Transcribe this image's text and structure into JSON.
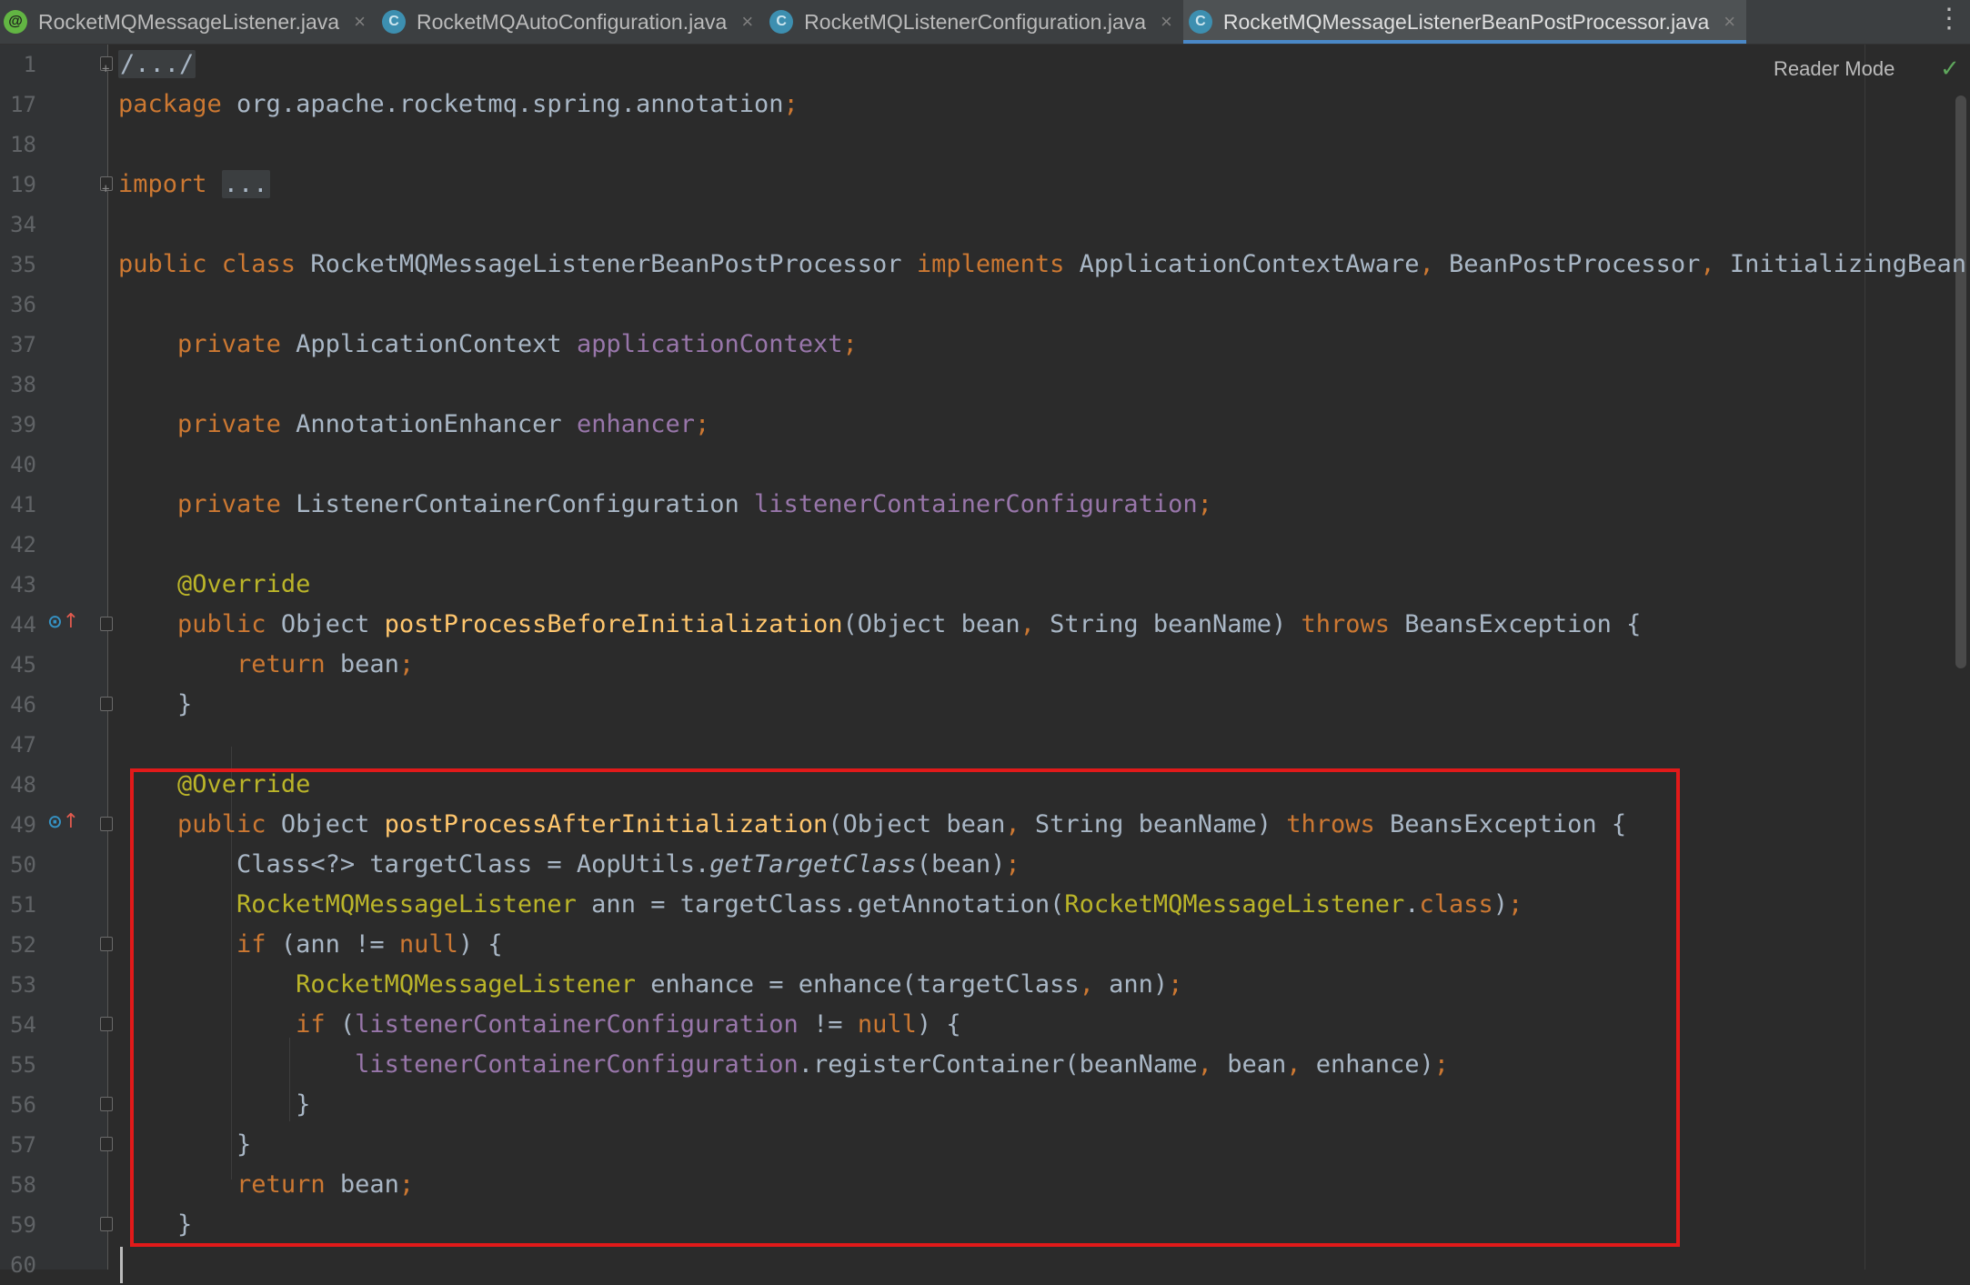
{
  "tabs": [
    {
      "label": "RocketMQMessageListener.java",
      "icon": "annotation-icon",
      "glyph": "@",
      "active": false
    },
    {
      "label": "RocketMQAutoConfiguration.java",
      "icon": "class-icon",
      "glyph": "C",
      "active": false
    },
    {
      "label": "RocketMQListenerConfiguration.java",
      "icon": "class-icon",
      "glyph": "C",
      "active": false
    },
    {
      "label": "RocketMQMessageListenerBeanPostProcessor.java",
      "icon": "class-icon",
      "glyph": "C",
      "active": true
    }
  ],
  "toolbar": {
    "reader_mode": "Reader Mode",
    "inspection_status": "✓",
    "menu": "⋮"
  },
  "colors": {
    "background": "#2b2b2b",
    "keyword": "#cc7832",
    "annotation": "#bbb529",
    "method": "#ffc66d",
    "field": "#9876aa",
    "text": "#a9b7c6",
    "highlight_box": "#e11a1a"
  },
  "lines": [
    {
      "n": "1",
      "tokens": [
        [
          "",
          "/.../"
        ]
      ]
    },
    {
      "n": "17",
      "tokens": [
        [
          "kw",
          "package "
        ],
        [
          "",
          "org.apache.rocketmq.spring.annotation"
        ],
        [
          "kw",
          ";"
        ]
      ]
    },
    {
      "n": "18",
      "tokens": []
    },
    {
      "n": "19",
      "tokens": [
        [
          "kw",
          "import "
        ],
        [
          "",
          "..."
        ]
      ]
    },
    {
      "n": "34",
      "tokens": []
    },
    {
      "n": "35",
      "tokens": [
        [
          "kw",
          "public class "
        ],
        [
          "",
          "RocketMQMessageListenerBeanPostProcessor "
        ],
        [
          "kw",
          "implements "
        ],
        [
          "",
          "ApplicationContextAware"
        ],
        [
          "kw",
          ", "
        ],
        [
          "",
          "BeanPostProcessor"
        ],
        [
          "kw",
          ", "
        ],
        [
          "",
          "InitializingBean {"
        ]
      ]
    },
    {
      "n": "36",
      "tokens": []
    },
    {
      "n": "37",
      "tokens": [
        [
          "",
          "    "
        ],
        [
          "kw",
          "private "
        ],
        [
          "",
          "ApplicationContext "
        ],
        [
          "field",
          "applicationContext"
        ],
        [
          "kw",
          ";"
        ]
      ]
    },
    {
      "n": "38",
      "tokens": []
    },
    {
      "n": "39",
      "tokens": [
        [
          "",
          "    "
        ],
        [
          "kw",
          "private "
        ],
        [
          "",
          "AnnotationEnhancer "
        ],
        [
          "field",
          "enhancer"
        ],
        [
          "kw",
          ";"
        ]
      ]
    },
    {
      "n": "40",
      "tokens": []
    },
    {
      "n": "41",
      "tokens": [
        [
          "",
          "    "
        ],
        [
          "kw",
          "private "
        ],
        [
          "",
          "ListenerContainerConfiguration "
        ],
        [
          "field",
          "listenerContainerConfiguration"
        ],
        [
          "kw",
          ";"
        ]
      ]
    },
    {
      "n": "42",
      "tokens": []
    },
    {
      "n": "43",
      "tokens": [
        [
          "",
          "    "
        ],
        [
          "ann",
          "@Override"
        ]
      ]
    },
    {
      "n": "44",
      "tokens": [
        [
          "",
          "    "
        ],
        [
          "kw",
          "public "
        ],
        [
          "",
          "Object "
        ],
        [
          "fn",
          "postProcessBeforeInitialization"
        ],
        [
          "",
          "(Object bean"
        ],
        [
          "kw",
          ", "
        ],
        [
          "",
          "String beanName) "
        ],
        [
          "kw",
          "throws "
        ],
        [
          "",
          "BeansException {"
        ]
      ]
    },
    {
      "n": "45",
      "tokens": [
        [
          "",
          "        "
        ],
        [
          "kw",
          "return "
        ],
        [
          "",
          "bean"
        ],
        [
          "kw",
          ";"
        ]
      ]
    },
    {
      "n": "46",
      "tokens": [
        [
          "",
          "    }"
        ]
      ]
    },
    {
      "n": "47",
      "tokens": []
    },
    {
      "n": "48",
      "tokens": [
        [
          "",
          "    "
        ],
        [
          "ann",
          "@Override"
        ]
      ]
    },
    {
      "n": "49",
      "tokens": [
        [
          "",
          "    "
        ],
        [
          "kw",
          "public "
        ],
        [
          "",
          "Object "
        ],
        [
          "fn",
          "postProcessAfterInitialization"
        ],
        [
          "",
          "(Object bean"
        ],
        [
          "kw",
          ", "
        ],
        [
          "",
          "String beanName) "
        ],
        [
          "kw",
          "throws "
        ],
        [
          "",
          "BeansException {"
        ]
      ]
    },
    {
      "n": "50",
      "tokens": [
        [
          "",
          "        Class<?> targetClass = AopUtils."
        ],
        [
          "it",
          "getTargetClass"
        ],
        [
          "",
          "(bean)"
        ],
        [
          "kw",
          ";"
        ]
      ]
    },
    {
      "n": "51",
      "tokens": [
        [
          "",
          "        "
        ],
        [
          "iface",
          "RocketMQMessageListener"
        ],
        [
          "",
          " ann = targetClass.getAnnotation("
        ],
        [
          "iface",
          "RocketMQMessageListener"
        ],
        [
          "",
          "."
        ],
        [
          "kw",
          "class"
        ],
        [
          "",
          ")"
        ],
        [
          "kw",
          ";"
        ]
      ]
    },
    {
      "n": "52",
      "tokens": [
        [
          "",
          "        "
        ],
        [
          "kw",
          "if "
        ],
        [
          "",
          "(ann != "
        ],
        [
          "kw",
          "null"
        ],
        [
          "",
          ") {"
        ]
      ]
    },
    {
      "n": "53",
      "tokens": [
        [
          "",
          "            "
        ],
        [
          "iface",
          "RocketMQMessageListener"
        ],
        [
          "",
          " enhance = enhance(targetClass"
        ],
        [
          "kw",
          ", "
        ],
        [
          "",
          "ann)"
        ],
        [
          "kw",
          ";"
        ]
      ]
    },
    {
      "n": "54",
      "tokens": [
        [
          "",
          "            "
        ],
        [
          "kw",
          "if "
        ],
        [
          "",
          "("
        ],
        [
          "field",
          "listenerContainerConfiguration"
        ],
        [
          "",
          " != "
        ],
        [
          "kw",
          "null"
        ],
        [
          "",
          ") {"
        ]
      ]
    },
    {
      "n": "55",
      "tokens": [
        [
          "",
          "                "
        ],
        [
          "field",
          "listenerContainerConfiguration"
        ],
        [
          "",
          ".registerContainer(beanName"
        ],
        [
          "kw",
          ", "
        ],
        [
          "",
          "bean"
        ],
        [
          "kw",
          ", "
        ],
        [
          "",
          "enhance)"
        ],
        [
          "kw",
          ";"
        ]
      ]
    },
    {
      "n": "56",
      "tokens": [
        [
          "",
          "            }"
        ]
      ]
    },
    {
      "n": "57",
      "tokens": [
        [
          "",
          "        }"
        ]
      ]
    },
    {
      "n": "58",
      "tokens": [
        [
          "",
          "        "
        ],
        [
          "kw",
          "return "
        ],
        [
          "",
          "bean"
        ],
        [
          "kw",
          ";"
        ]
      ]
    },
    {
      "n": "59",
      "tokens": [
        [
          "",
          "    }"
        ]
      ]
    },
    {
      "n": "60",
      "tokens": []
    }
  ],
  "override_markers": [
    "44",
    "49"
  ],
  "fold_markers": {
    "1": "plus",
    "19": "plus",
    "44": "minus",
    "46": "minus",
    "49": "minus",
    "52": "minus",
    "54": "minus",
    "56": "minus",
    "57": "minus",
    "59": "minus"
  }
}
